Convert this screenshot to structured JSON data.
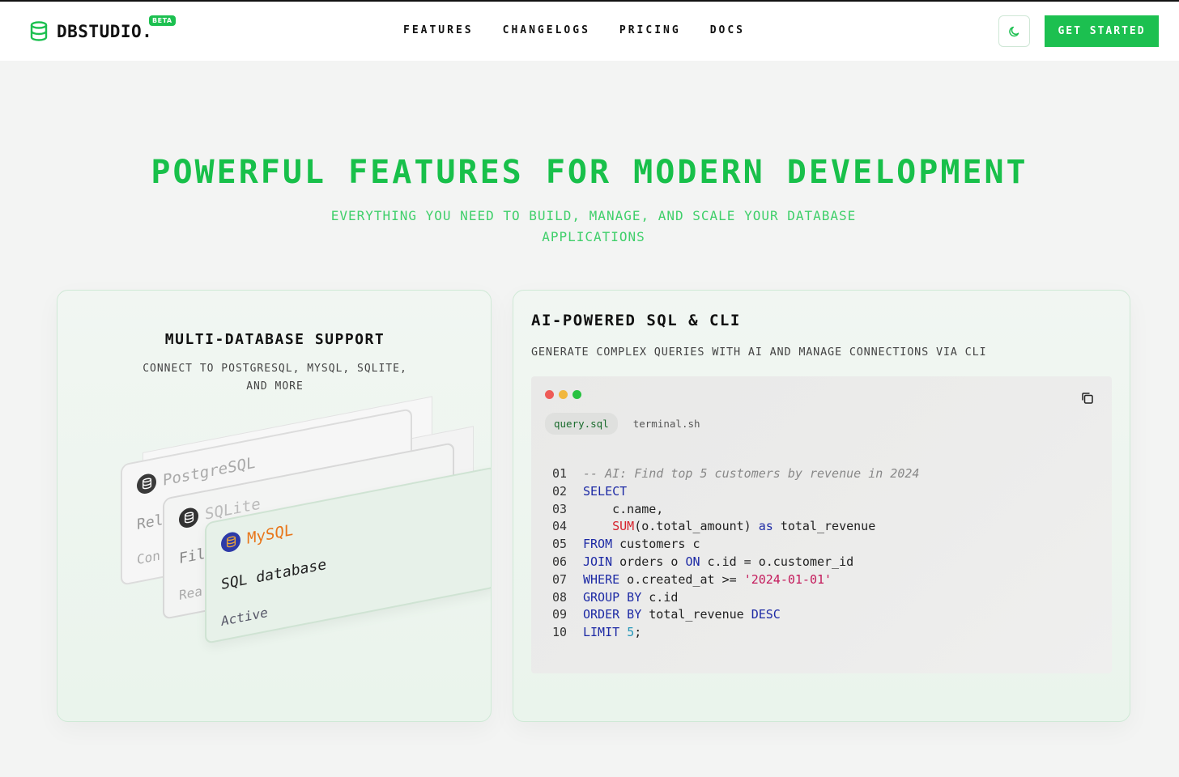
{
  "brand": {
    "name": "DBSTUDIO.",
    "badge": "BETA",
    "color": "#1cc050"
  },
  "nav": {
    "items": [
      "FEATURES",
      "CHANGELOGS",
      "PRICING",
      "DOCS"
    ],
    "cta_label": "GET STARTED",
    "theme_icon": "moon-icon"
  },
  "hero": {
    "title": "POWERFUL FEATURES FOR MODERN DEVELOPMENT",
    "subtitle_line1": "EVERYTHING YOU NEED TO BUILD, MANAGE, AND SCALE YOUR DATABASE",
    "subtitle_line2": "APPLICATIONS"
  },
  "multi_db": {
    "title": "MULTI-DATABASE SUPPORT",
    "subtitle_line1": "CONNECT TO POSTGRESQL, MYSQL, SQLITE,",
    "subtitle_line2": "AND MORE",
    "cards": [
      {
        "name": "PostgreSQL",
        "desc": "Rel",
        "status": "Con",
        "icon": "database-icon"
      },
      {
        "name": "SQLite",
        "desc": "Fil",
        "status": "Rea",
        "icon": "database-icon"
      },
      {
        "name": "MySQL",
        "desc": "SQL database",
        "status": "Active",
        "icon": "database-icon",
        "accent": "#e8761a"
      }
    ]
  },
  "ai_sql": {
    "title": "AI-POWERED SQL & CLI",
    "subtitle": "GENERATE COMPLEX QUERIES WITH AI AND MANAGE CONNECTIONS VIA CLI",
    "tabs": [
      "query.sql",
      "terminal.sh"
    ],
    "active_tab": "query.sql",
    "copy_icon": "copy-icon",
    "window_dots": [
      "#ee5b57",
      "#f1b73d",
      "#27c240"
    ],
    "lines": [
      {
        "n": "01",
        "tokens": [
          {
            "t": "-- AI: Find top 5 customers by revenue in 2024",
            "c": "comment"
          }
        ]
      },
      {
        "n": "02",
        "tokens": [
          {
            "t": "SELECT",
            "c": "kw"
          }
        ]
      },
      {
        "n": "03",
        "tokens": [
          {
            "t": "    c.name,",
            "c": "plain"
          }
        ]
      },
      {
        "n": "04",
        "tokens": [
          {
            "t": "    ",
            "c": "plain"
          },
          {
            "t": "SUM",
            "c": "fn"
          },
          {
            "t": "(o.total_amount) ",
            "c": "plain"
          },
          {
            "t": "as",
            "c": "kw"
          },
          {
            "t": " total_revenue",
            "c": "plain"
          }
        ]
      },
      {
        "n": "05",
        "tokens": [
          {
            "t": "FROM",
            "c": "kw"
          },
          {
            "t": " customers c",
            "c": "plain"
          }
        ]
      },
      {
        "n": "06",
        "tokens": [
          {
            "t": "JOIN",
            "c": "kw"
          },
          {
            "t": " orders o ",
            "c": "plain"
          },
          {
            "t": "ON",
            "c": "kw"
          },
          {
            "t": " c.id = o.customer_id",
            "c": "plain"
          }
        ]
      },
      {
        "n": "07",
        "tokens": [
          {
            "t": "WHERE",
            "c": "kw"
          },
          {
            "t": " o.created_at >= ",
            "c": "plain"
          },
          {
            "t": "'2024-01-01'",
            "c": "str"
          }
        ]
      },
      {
        "n": "08",
        "tokens": [
          {
            "t": "GROUP BY",
            "c": "kw"
          },
          {
            "t": " c.id",
            "c": "plain"
          }
        ]
      },
      {
        "n": "09",
        "tokens": [
          {
            "t": "ORDER BY",
            "c": "kw"
          },
          {
            "t": " total_revenue ",
            "c": "plain"
          },
          {
            "t": "DESC",
            "c": "kw"
          }
        ]
      },
      {
        "n": "10",
        "tokens": [
          {
            "t": "LIMIT",
            "c": "kw"
          },
          {
            "t": " ",
            "c": "plain"
          },
          {
            "t": "5",
            "c": "num"
          },
          {
            "t": ";",
            "c": "plain"
          }
        ]
      }
    ]
  }
}
